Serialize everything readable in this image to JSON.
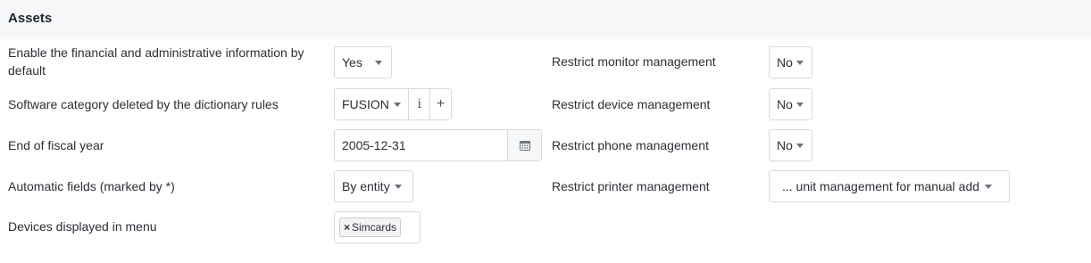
{
  "section": {
    "title": "Assets"
  },
  "left": {
    "financial_info_label": "Enable the financial and administrative information by default",
    "financial_info_value": "Yes",
    "software_category_label": "Software category deleted by the dictionary rules",
    "software_category_value": "FUSION",
    "info_button": "i",
    "add_button": "+",
    "fiscal_year_label": "End of fiscal year",
    "fiscal_year_value": "2005-12-31",
    "auto_fields_label": "Automatic fields (marked by *)",
    "auto_fields_value": "By entity",
    "devices_menu_label": "Devices displayed in menu",
    "devices_menu_tags": [
      "Simcards"
    ],
    "tag_remove_glyph": "×"
  },
  "right": {
    "monitor_label": "Restrict monitor management",
    "monitor_value": "No",
    "device_label": "Restrict device management",
    "device_value": "No",
    "phone_label": "Restrict phone management",
    "phone_value": "No",
    "printer_label": "Restrict printer management",
    "printer_value": "... unit management for manual add"
  },
  "icons": {
    "calendar": "calendar-icon",
    "dropdown": "chevron-down-icon"
  }
}
